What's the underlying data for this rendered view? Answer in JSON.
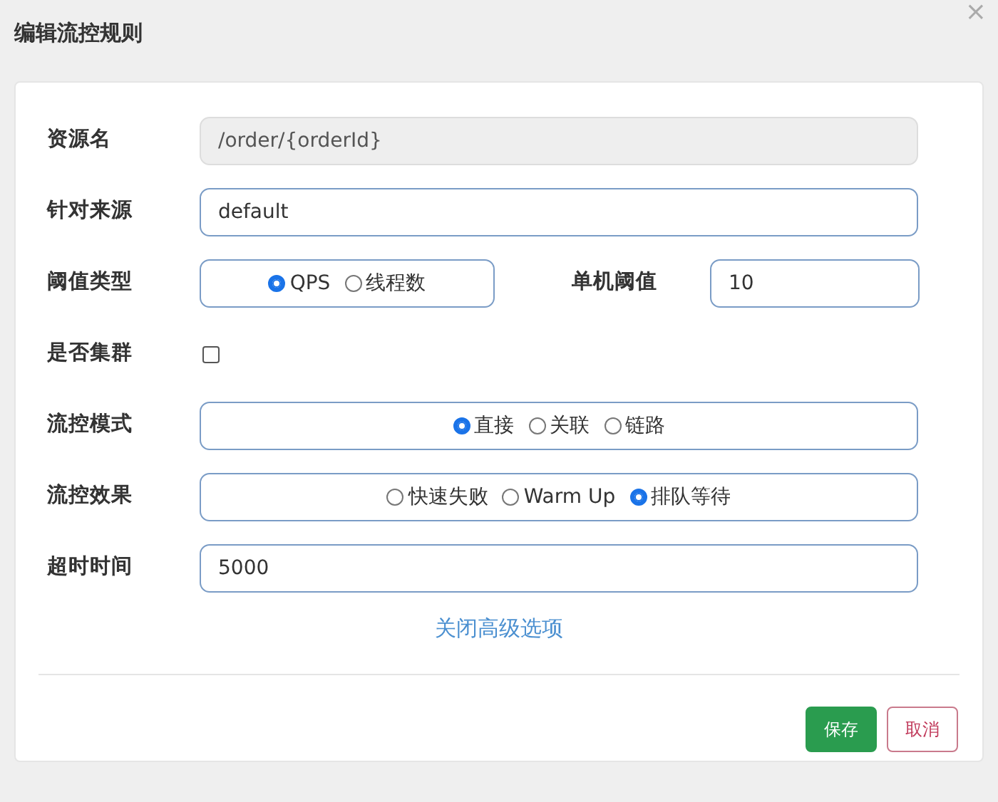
{
  "dialog": {
    "title": "编辑流控规则",
    "close": "×"
  },
  "rows": [
    {
      "kind": "text",
      "label": "资源名",
      "value": "/order/{orderId}",
      "disabled": true
    },
    {
      "kind": "text",
      "label": "针对来源",
      "value": "default",
      "disabled": false
    },
    {
      "kind": "radio",
      "label": "阈值类型",
      "options": [
        {
          "label": "QPS",
          "selected": true
        },
        {
          "label": "线程数",
          "selected": false
        }
      ],
      "side": {
        "label": "单机阈值",
        "value": "10"
      }
    },
    {
      "kind": "checkbox",
      "label": "是否集群",
      "checked": false
    },
    {
      "kind": "radio",
      "label": "流控模式",
      "options": [
        {
          "label": "直接",
          "selected": true
        },
        {
          "label": "关联",
          "selected": false
        },
        {
          "label": "链路",
          "selected": false
        }
      ]
    },
    {
      "kind": "radio",
      "label": "流控效果",
      "options": [
        {
          "label": "快速失败",
          "selected": false
        },
        {
          "label": "Warm Up",
          "selected": false
        },
        {
          "label": "排队等待",
          "selected": true
        }
      ]
    },
    {
      "kind": "text",
      "label": "超时时间",
      "value": "5000",
      "disabled": false
    }
  ],
  "advanced_link": "关闭高级选项",
  "buttons": [
    {
      "kind": "save",
      "label": "保存"
    },
    {
      "kind": "cancel",
      "label": "取消"
    }
  ]
}
